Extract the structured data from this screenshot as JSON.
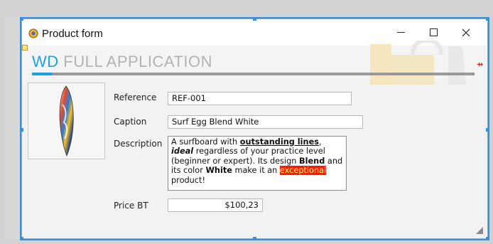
{
  "window": {
    "title": "Product form",
    "app_icon": "windev-app-icon"
  },
  "banner": {
    "wd": "WD",
    "rest": " FULL APPLICATION"
  },
  "form": {
    "reference_label": "Reference",
    "reference_value": "REF-001",
    "caption_label": "Caption",
    "caption_value": "Surf Egg Blend White",
    "description_label": "Description",
    "description": {
      "p1": "A surfboard with ",
      "b1": "outstanding lines",
      "p2": ", ",
      "i1": "ideal",
      "p3": " regardless of your practice level (beginner or expert). Its design ",
      "b2": "Blend",
      "p4": " and its color ",
      "b3": "White",
      "p5": " make it an ",
      "hl": "exceptional",
      "p6": " product!"
    },
    "price_label": "Price BT",
    "price_value": "$100,23"
  },
  "colors": {
    "accent": "#1ea2e6",
    "highlight_bg": "#ff1a00",
    "highlight_fg": "#ffff66",
    "selection": "#3a8fd8"
  }
}
